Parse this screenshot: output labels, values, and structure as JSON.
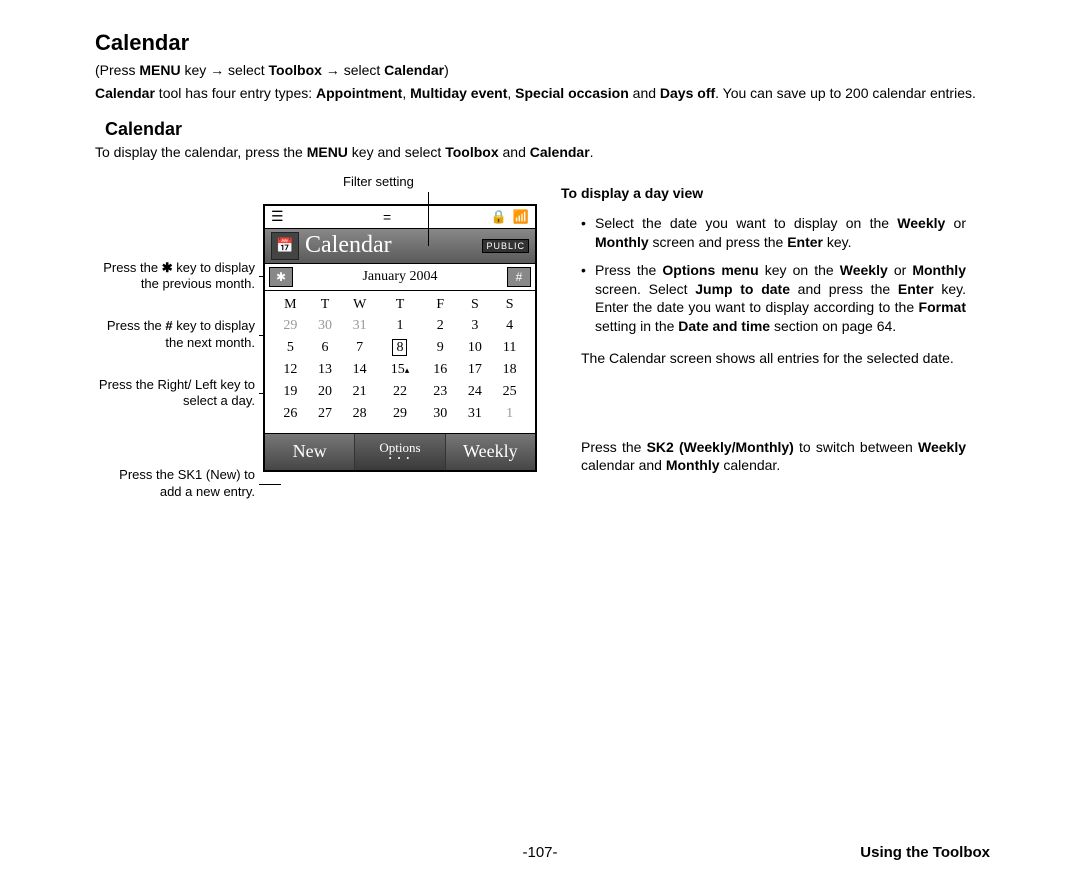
{
  "heading1": "Calendar",
  "nav": {
    "open": "(",
    "press": "Press ",
    "menu": "MENU",
    "key_arrow": " key → select ",
    "toolbox": "Toolbox",
    "arrow2": "  → select ",
    "calendar": "Calendar",
    "close": ")"
  },
  "intro": {
    "p1a": "Calendar",
    "p1b": " tool has four entry types: ",
    "t1": "Appointment",
    "c1": ", ",
    "t2": "Multiday event",
    "c2": ", ",
    "t3": "Special occasion",
    "and": " and ",
    "t4": "Days off",
    "p1c": ". You can save up to 200 calendar entries."
  },
  "heading2": "Calendar",
  "display_line": {
    "a": "To display the calendar, press the ",
    "b": "MENU",
    "c": " key and select ",
    "d": "Toolbox",
    "e": " and ",
    "f": "Calendar",
    "g": "."
  },
  "filter_label": "Filter setting",
  "callouts": {
    "c1a": "Press the ",
    "c1star": "✱",
    "c1b": " key to display the previous month.",
    "c2a": "Press the ",
    "c2hash": "#",
    "c2b": " key to display the next month.",
    "c3": "Press the Right/ Left key to select a day.",
    "c4": "Press the SK1 (New) to add a new entry."
  },
  "phone": {
    "title": "Calendar",
    "badge": "PUBLIC",
    "star_key": "✱",
    "hash_key": "#",
    "month": "January 2004",
    "dow": [
      "M",
      "T",
      "W",
      "T",
      "F",
      "S",
      "S"
    ],
    "rows": [
      [
        "29",
        "30",
        "31",
        "1",
        "2",
        "3",
        "4"
      ],
      [
        "5",
        "6",
        "7",
        "8",
        "9",
        "10",
        "11"
      ],
      [
        "12",
        "13",
        "14",
        "15",
        "16",
        "17",
        "18"
      ],
      [
        "19",
        "20",
        "21",
        "22",
        "23",
        "24",
        "25"
      ],
      [
        "26",
        "27",
        "28",
        "29",
        "30",
        "31",
        "1"
      ]
    ],
    "sk_new": "New",
    "sk_options": "Options",
    "sk_weekly": "Weekly"
  },
  "right": {
    "h": "To display a day view",
    "b1a": "Select the date you want to display on the ",
    "b1b": "Weekly",
    "b1c": " or ",
    "b1d": "Monthly",
    "b1e": " screen and press the ",
    "b1f": "Enter",
    "b1g": " key.",
    "b2a": "Press the ",
    "b2b": "Options menu",
    "b2c": " key on the ",
    "b2d": "Weekly",
    "b2e": " or ",
    "b2f": "Monthly",
    "b2g": " screen. Select ",
    "b2h": "Jump to date",
    "b2i": " and press the ",
    "b2j": "Enter",
    "b2k": " key. Enter the date you want to display according to the ",
    "b2l": "Format",
    "b2m": " setting in the ",
    "b2n": "Date and time",
    "b2o": " section on page 64.",
    "note": "The Calendar screen shows all entries for the selected date.",
    "sk2a": "Press the ",
    "sk2b": "SK2 (Weekly/Monthly)",
    "sk2c": " to switch between ",
    "sk2d": "Weekly",
    "sk2e": " calendar and ",
    "sk2f": "Monthly",
    "sk2g": " calendar."
  },
  "footer": {
    "page": "-107-",
    "section": "Using the Toolbox"
  }
}
